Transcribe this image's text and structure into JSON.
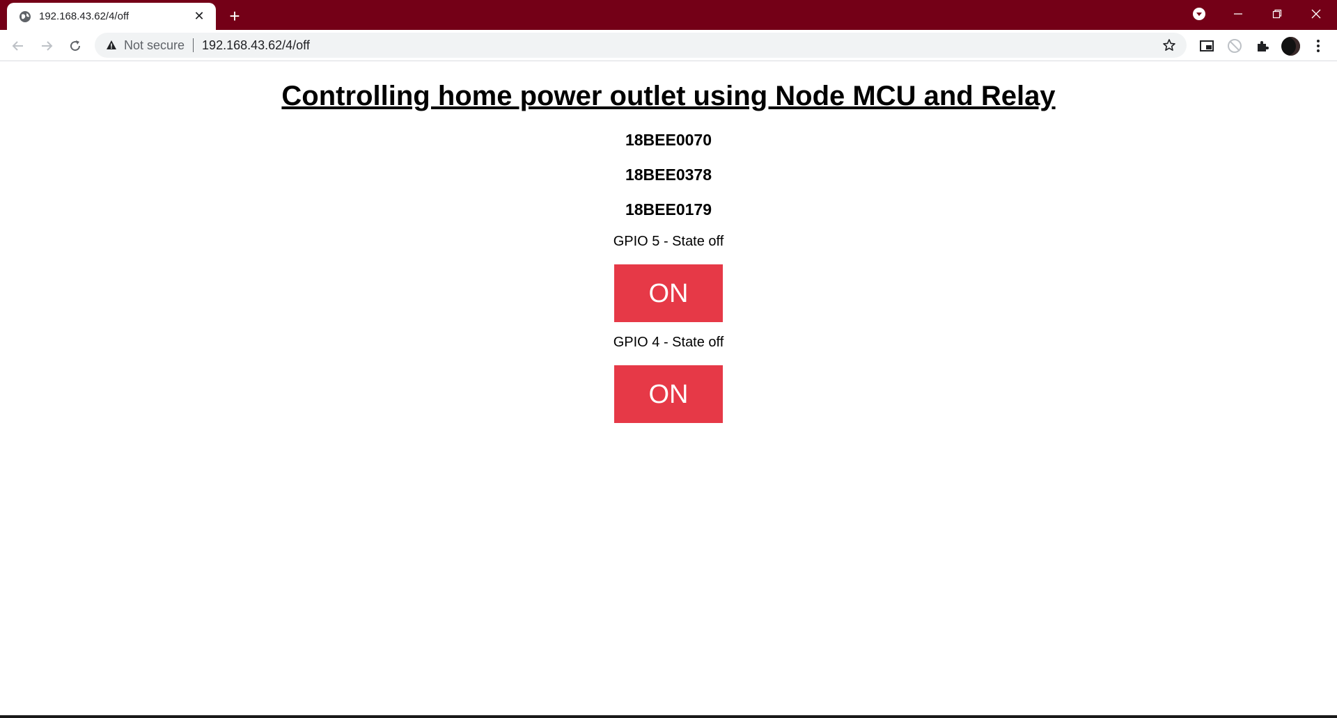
{
  "browser": {
    "tab_title": "192.168.43.62/4/off",
    "security_label": "Not secure",
    "url": "192.168.43.62/4/off",
    "colors": {
      "titlebar": "#740017",
      "button": "#e63947"
    }
  },
  "page": {
    "title": "Controlling home power outlet using Node MCU and Relay",
    "student_ids": [
      "18BEE0070",
      "18BEE0378",
      "18BEE0179"
    ],
    "gpios": [
      {
        "state_label": "GPIO 5 - State off",
        "button_label": "ON"
      },
      {
        "state_label": "GPIO 4 - State off",
        "button_label": "ON"
      }
    ]
  }
}
